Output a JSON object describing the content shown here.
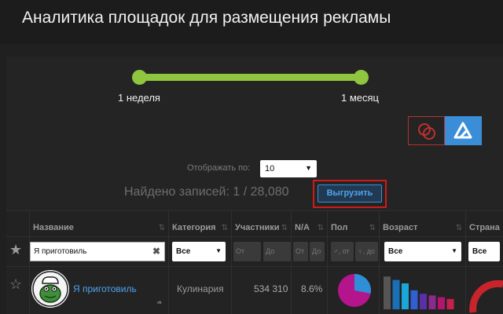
{
  "header": {
    "title": "Аналитика площадок для размещения рекламы"
  },
  "slider": {
    "min_label": "1 неделя",
    "max_label": "1 месяц",
    "accent": "#8fc53f"
  },
  "toolbar": {
    "per_page_label": "Отображать по:",
    "per_page_value": "10",
    "found_text": "Найдено записей: 1 / 28,080",
    "export_label": "Выгрузить",
    "highlight_color": "#d11a1a"
  },
  "table": {
    "columns": [
      "Название",
      "Категория",
      "Участники",
      "N/A",
      "Пол",
      "Возраст",
      "Страна"
    ],
    "filters": {
      "name_value": "Я приготовиль",
      "category": "Все",
      "members_from": "От",
      "members_to": "До",
      "na_from": "От",
      "na_to": "До",
      "gender_from": "♂, от",
      "gender_to": "♀, до",
      "age": "Все",
      "country": "Все"
    },
    "rows": [
      {
        "name": "Я приготовиль",
        "network": "vk",
        "category": "Кулинария",
        "members": "534 310",
        "na": "8.6%",
        "gender_pie": {
          "male": 0.28,
          "female": 0.72
        },
        "age_bars": [
          0.95,
          0.85,
          0.75,
          0.55,
          0.45,
          0.4,
          0.35,
          0.3
        ]
      }
    ]
  },
  "colors": {
    "link": "#4fa3ee",
    "toggle_active": "#3a8ed8",
    "pie_female": "#b4148c",
    "pie_male": "#2f8fd6"
  }
}
